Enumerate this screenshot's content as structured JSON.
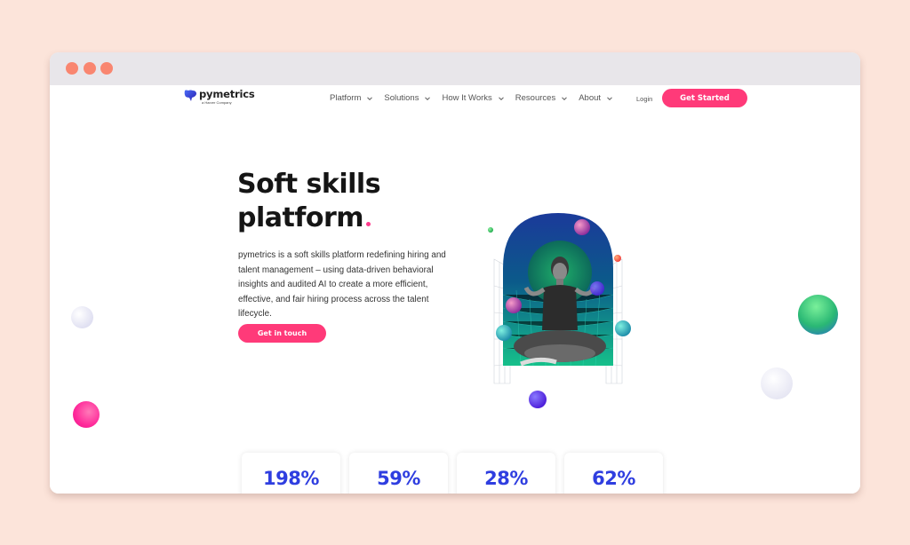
{
  "window": {
    "controls": [
      "close",
      "minimize",
      "maximize"
    ]
  },
  "header": {
    "logo_name": "pymetrics",
    "logo_subtitle": "a Harver Company",
    "nav": [
      {
        "label": "Platform",
        "icon": "chevron-down-icon"
      },
      {
        "label": "Solutions",
        "icon": "chevron-down-icon"
      },
      {
        "label": "How It Works",
        "icon": "chevron-down-icon"
      },
      {
        "label": "Resources",
        "icon": "chevron-down-icon"
      },
      {
        "label": "About",
        "icon": "chevron-down-icon"
      }
    ],
    "login_label": "Login",
    "cta_label": "Get Started"
  },
  "hero": {
    "title_line1": "Soft skills",
    "title_line2": "platform",
    "description": "pymetrics is a soft skills platform redefining hiring and talent management – using data-driven behavioral insights and audited AI to create a more efficient, effective, and fair hiring process across the talent lifecycle.",
    "cta_label": "Get in touch"
  },
  "stats": [
    {
      "value": "198%"
    },
    {
      "value": "59%"
    },
    {
      "value": "28%"
    },
    {
      "value": "62%"
    }
  ],
  "colors": {
    "accent": "#ff3a79",
    "stat_blue": "#2f3ee0",
    "background": "#fce4da",
    "titlebar": "#e8e6ea",
    "window_dot": "#f98670"
  }
}
